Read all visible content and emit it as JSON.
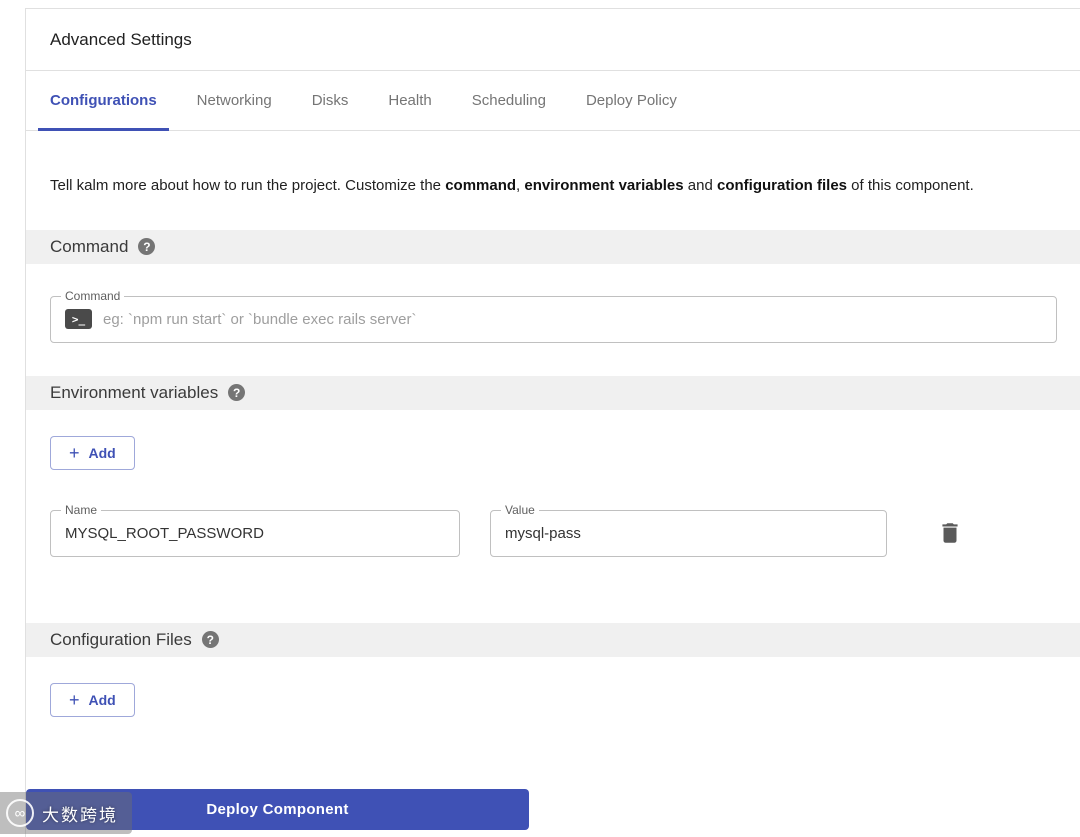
{
  "panel": {
    "title": "Advanced Settings"
  },
  "tabs": [
    {
      "label": "Configurations",
      "active": true
    },
    {
      "label": "Networking",
      "active": false
    },
    {
      "label": "Disks",
      "active": false
    },
    {
      "label": "Health",
      "active": false
    },
    {
      "label": "Scheduling",
      "active": false
    },
    {
      "label": "Deploy Policy",
      "active": false
    }
  ],
  "description": {
    "part1": "Tell kalm more about how to run the project. Customize the ",
    "bold1": "command",
    "part2": ", ",
    "bold2": "environment variables",
    "part3": " and ",
    "bold3": "configuration files",
    "part4": " of this component."
  },
  "command_section": {
    "title": "Command",
    "field_label": "Command",
    "placeholder": "eg: `npm run start` or `bundle exec rails server`"
  },
  "env_section": {
    "title": "Environment variables",
    "add_label": "Add",
    "rows": [
      {
        "name_label": "Name",
        "name": "MYSQL_ROOT_PASSWORD",
        "value_label": "Value",
        "value": "mysql-pass"
      }
    ]
  },
  "config_section": {
    "title": "Configuration Files",
    "add_label": "Add"
  },
  "footer": {
    "deploy_label": "Deploy Component"
  },
  "watermark": {
    "text": "大数跨境",
    "logo_glyph": "∞"
  },
  "icons": {
    "help": "?",
    "plus": "+",
    "terminal": ">_"
  },
  "colors": {
    "primary": "#3f51b5",
    "section_bar_bg": "#f0f0f0",
    "border": "#e0e0e0"
  }
}
